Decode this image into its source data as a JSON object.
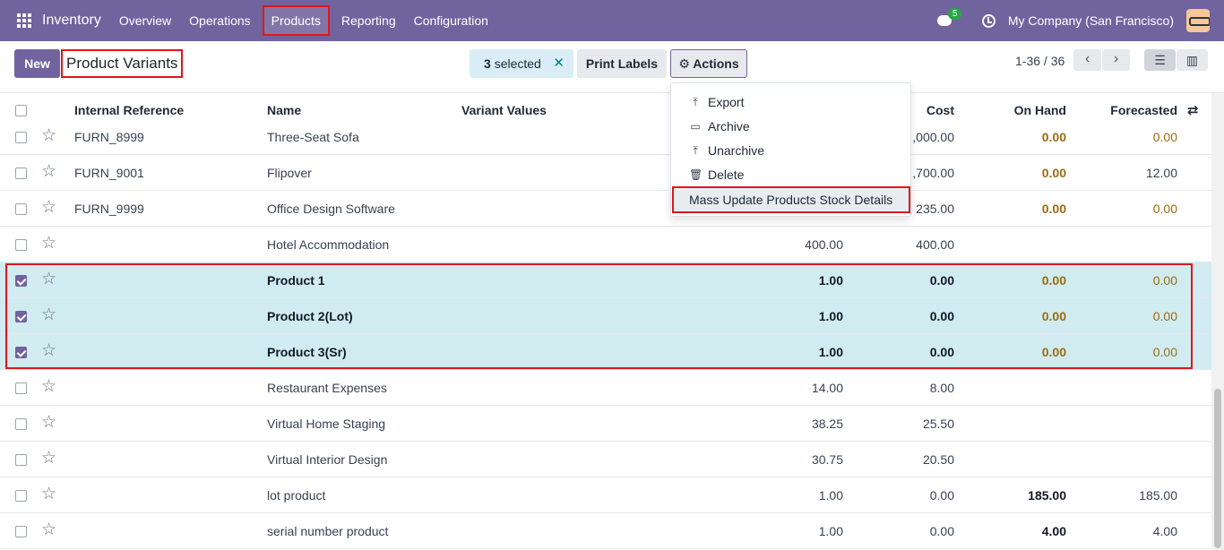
{
  "navbar": {
    "app_name": "Inventory",
    "menu": [
      "Overview",
      "Operations",
      "Products",
      "Reporting",
      "Configuration"
    ],
    "chat_badge": "5",
    "company": "My Company (San Francisco)"
  },
  "control_panel": {
    "new_label": "New",
    "breadcrumb": "Product Variants",
    "selected_count": "3",
    "selected_label": "selected",
    "print_labels": "Print Labels",
    "actions_label": "Actions",
    "pager": "1-36 / 36"
  },
  "actions_menu": {
    "items": [
      "Export",
      "Archive",
      "Unarchive",
      "Delete"
    ],
    "mass_update": "Mass Update Products Stock Details"
  },
  "table": {
    "headers": {
      "internal_reference": "Internal Reference",
      "name": "Name",
      "variant_values": "Variant Values",
      "cost": "Cost",
      "on_hand": "On Hand",
      "forecasted": "Forecasted"
    },
    "rows": [
      {
        "ref": "FURN_8999",
        "name": "Three-Seat Sofa",
        "price": "",
        "cost": ",000.00",
        "on_hand": "0.00",
        "forecasted": "0.00",
        "selected": false
      },
      {
        "ref": "FURN_9001",
        "name": "Flipover",
        "price": "",
        "cost": ",700.00",
        "on_hand": "0.00",
        "forecasted": "12.00",
        "selected": false
      },
      {
        "ref": "FURN_9999",
        "name": "Office Design Software",
        "price": "",
        "cost": "235.00",
        "on_hand": "0.00",
        "forecasted": "0.00",
        "selected": false
      },
      {
        "ref": "",
        "name": "Hotel Accommodation",
        "price": "400.00",
        "cost": "400.00",
        "on_hand": "",
        "forecasted": "",
        "selected": false
      },
      {
        "ref": "",
        "name": "Product 1",
        "price": "1.00",
        "cost": "0.00",
        "on_hand": "0.00",
        "forecasted": "0.00",
        "selected": true
      },
      {
        "ref": "",
        "name": "Product 2(Lot)",
        "price": "1.00",
        "cost": "0.00",
        "on_hand": "0.00",
        "forecasted": "0.00",
        "selected": true
      },
      {
        "ref": "",
        "name": "Product 3(Sr)",
        "price": "1.00",
        "cost": "0.00",
        "on_hand": "0.00",
        "forecasted": "0.00",
        "selected": true
      },
      {
        "ref": "",
        "name": "Restaurant Expenses",
        "price": "14.00",
        "cost": "8.00",
        "on_hand": "",
        "forecasted": "",
        "selected": false
      },
      {
        "ref": "",
        "name": "Virtual Home Staging",
        "price": "38.25",
        "cost": "25.50",
        "on_hand": "",
        "forecasted": "",
        "selected": false
      },
      {
        "ref": "",
        "name": "Virtual Interior Design",
        "price": "30.75",
        "cost": "20.50",
        "on_hand": "",
        "forecasted": "",
        "selected": false
      },
      {
        "ref": "",
        "name": "lot product",
        "price": "1.00",
        "cost": "0.00",
        "on_hand": "185.00",
        "forecasted": "185.00",
        "selected": false
      },
      {
        "ref": "",
        "name": "serial number product",
        "price": "1.00",
        "cost": "0.00",
        "on_hand": "4.00",
        "forecasted": "4.00",
        "selected": false
      }
    ]
  }
}
